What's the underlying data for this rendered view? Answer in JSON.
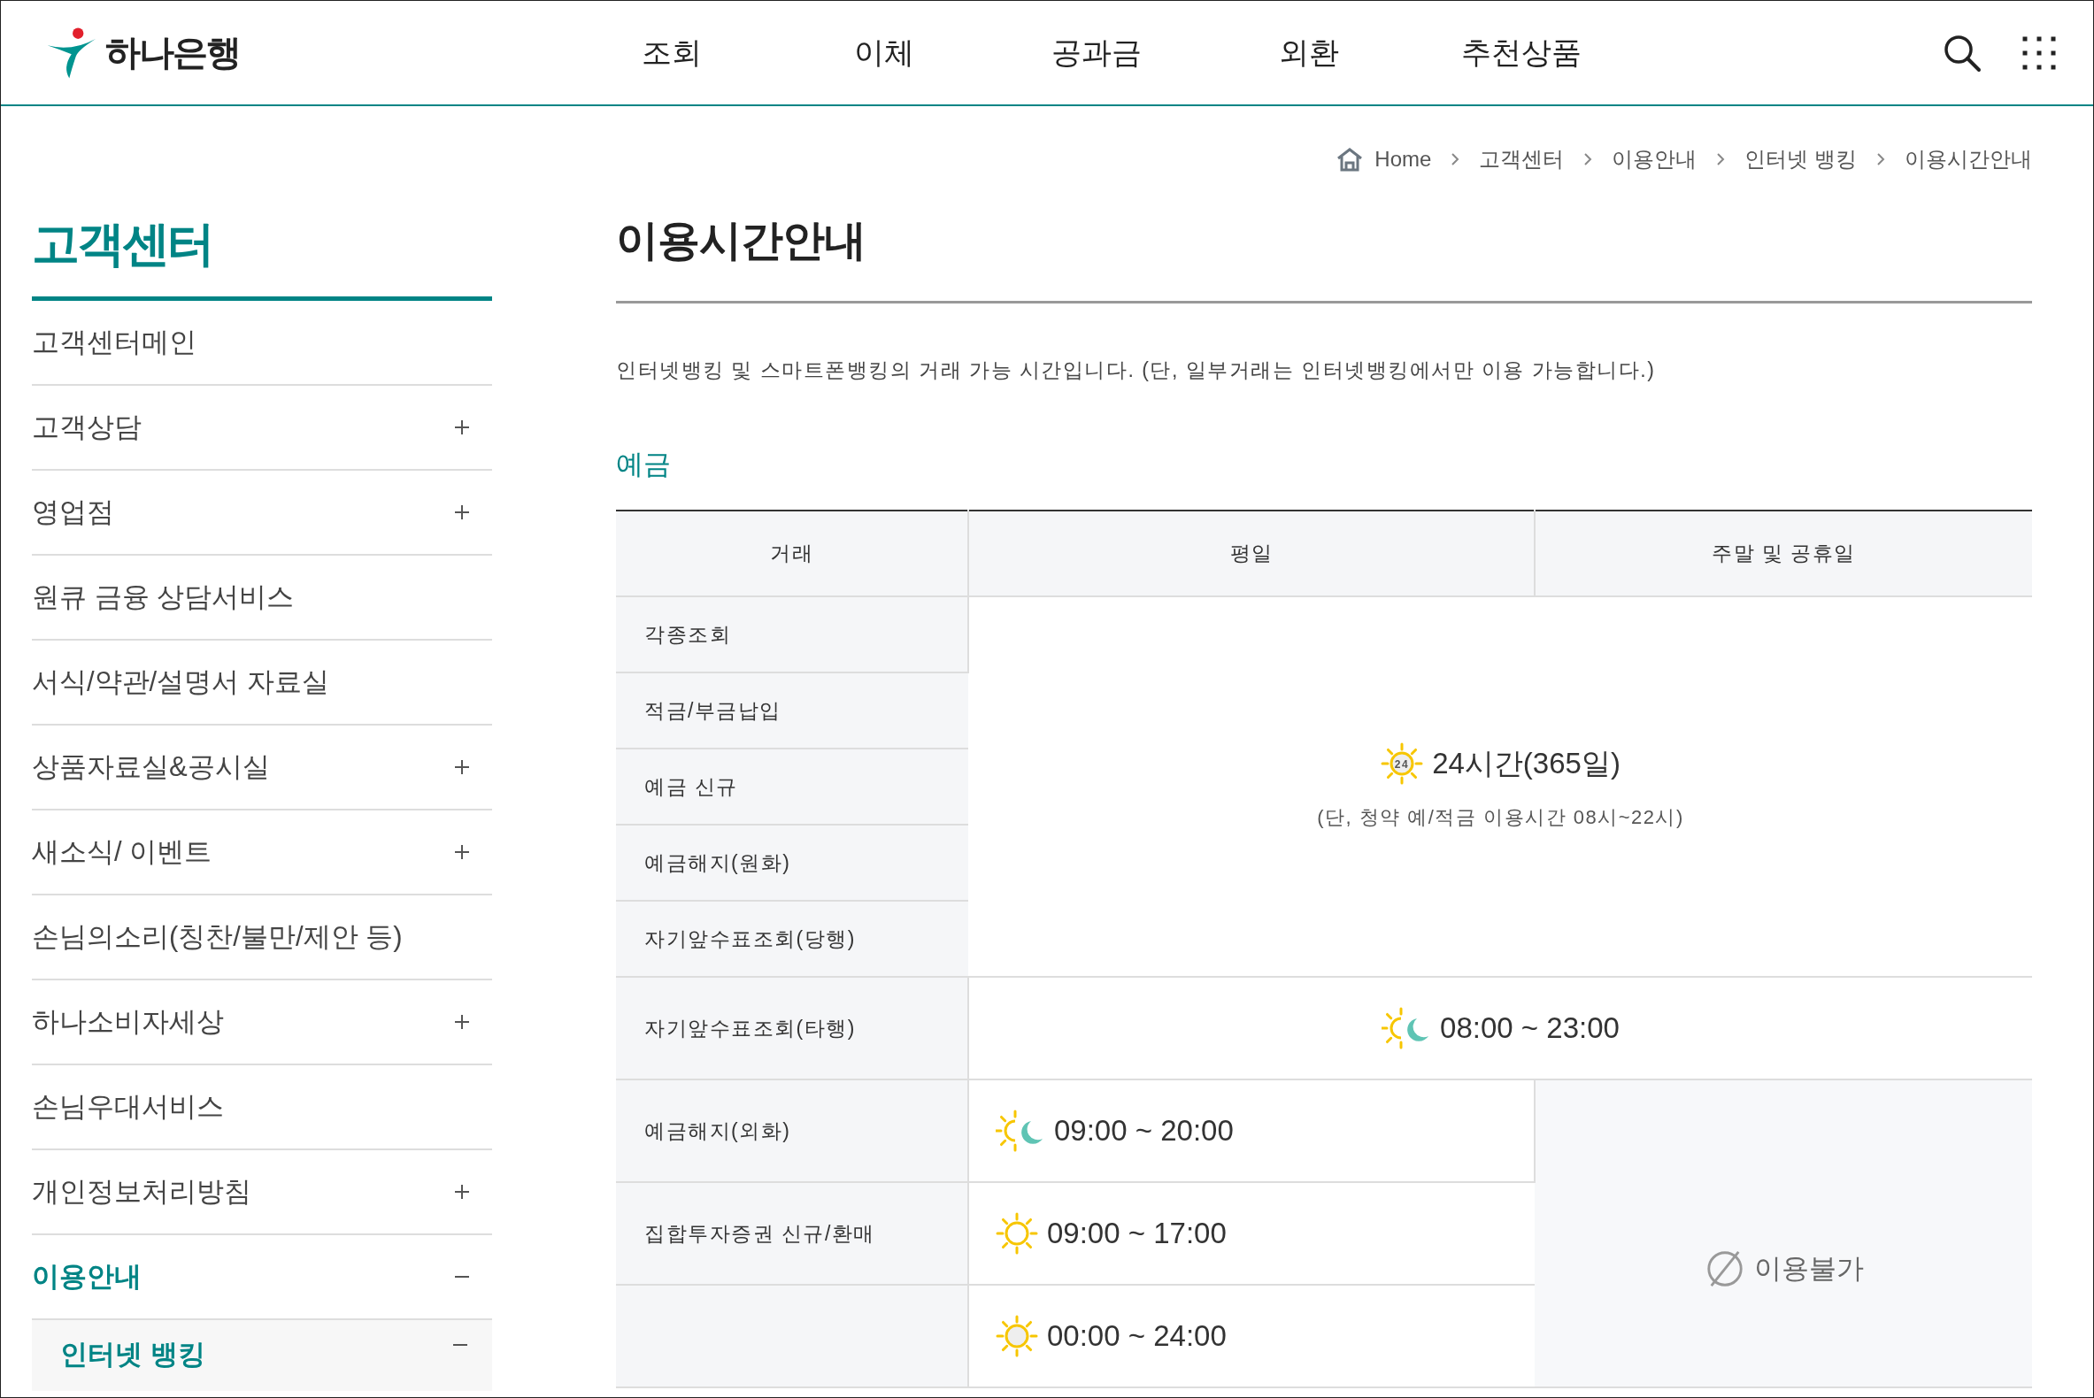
{
  "header": {
    "logo": "하나은행",
    "nav": [
      "조회",
      "이체",
      "공과금",
      "외환",
      "추천상품"
    ]
  },
  "breadcrumb": [
    "Home",
    "고객센터",
    "이용안내",
    "인터넷 뱅킹",
    "이용시간안내"
  ],
  "sidebar": {
    "title": "고객센터",
    "items": [
      {
        "label": "고객센터메인",
        "selected": false
      },
      {
        "label": "고객상담",
        "expanded": false,
        "selected": false
      },
      {
        "label": "영업점",
        "expanded": false,
        "selected": false
      },
      {
        "label": "원큐 금융 상담서비스",
        "selected": false
      },
      {
        "label": "서식/약관/설명서 자료실",
        "selected": false
      },
      {
        "label": "상품자료실&공시실",
        "expanded": false,
        "selected": false
      },
      {
        "label": "새소식/ 이벤트",
        "expanded": false,
        "selected": false
      },
      {
        "label": "손님의소리(칭찬/불만/제안 등)",
        "selected": false
      },
      {
        "label": "하나소비자세상",
        "expanded": false,
        "selected": false
      },
      {
        "label": "손님우대서비스",
        "selected": false
      },
      {
        "label": "개인정보처리방침",
        "expanded": false,
        "selected": false
      },
      {
        "label": "이용안내",
        "expanded": true,
        "selected": true,
        "children": [
          {
            "label": "인터넷 뱅킹",
            "expanded": true,
            "selected": true
          }
        ]
      }
    ]
  },
  "page": {
    "title": "이용시간안내",
    "description": "인터넷뱅킹 및 스마트폰뱅킹의 거래 가능 시간입니다. (단, 일부거래는 인터넷뱅킹에서만 이용 가능합니다.)",
    "section": "예금",
    "table": {
      "columns": [
        "거래",
        "평일",
        "주말 및 공휴일"
      ],
      "groups": [
        {
          "kind": "all_days",
          "hours": {
            "kind": "round_the_clock",
            "icon_text": "24",
            "text": "24시간(365일)",
            "note": "(단, 청약 예/적금 이용시간 08시~22시)"
          },
          "rows": [
            "각종조회",
            "적금/부금납입",
            "예금 신규",
            "예금해지(원화)",
            "자기앞수표조회(당행)"
          ]
        },
        {
          "kind": "all_days",
          "hours": {
            "kind": "day_night",
            "text": "08:00 ~ 23:00"
          },
          "rows": [
            "자기앞수표조회(타행)"
          ]
        },
        {
          "kind": "weekdays_only",
          "weekend": "이용불가",
          "rows": [
            {
              "label": "예금해지(외화)",
              "hours": {
                "kind": "day_night",
                "text": "09:00 ~ 20:00"
              }
            },
            {
              "label": "집합투자증권 신규/환매",
              "hours": {
                "kind": "daytime",
                "text": "09:00 ~ 17:00"
              }
            },
            {
              "hours": {
                "kind": "round_the_clock",
                "text": "00:00 ~ 24:00"
              }
            }
          ]
        }
      ]
    }
  }
}
